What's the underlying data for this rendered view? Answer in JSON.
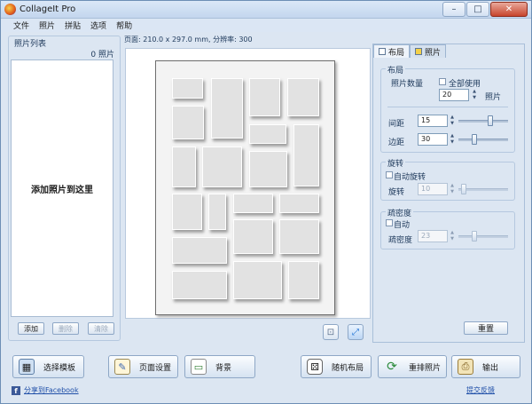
{
  "window": {
    "title": "CollageIt Pro",
    "min_glyph": "–",
    "max_glyph": "□",
    "close_glyph": "✕"
  },
  "menu": [
    "文件",
    "照片",
    "拼贴",
    "选项",
    "帮助"
  ],
  "photo_list": {
    "legend": "照片列表",
    "count": "0 照片",
    "hint": "添加照片到这里",
    "add_label": "添加",
    "delete_label": "删除",
    "clear_label": "清除"
  },
  "page_info": "页面: 210.0 x 297.0 mm, 分辨率: 300",
  "tabs": {
    "layout": "布局",
    "photo": "照片"
  },
  "layout_group": {
    "title": "布局",
    "photo_count_label": "照片数量",
    "use_all_label": "全部使用",
    "photo_count_value": "20",
    "photo_unit": "照片",
    "spacing_label": "间距",
    "spacing_value": "15",
    "spacing_level": 0.65,
    "margin_label": "边距",
    "margin_value": "30",
    "margin_level": 0.3
  },
  "rotation_group": {
    "title": "旋转",
    "auto_label": "自动旋转",
    "rotate_label": "旋转",
    "rotate_value": "10",
    "rotate_level": 0.05
  },
  "sparsity_group": {
    "title": "疏密度",
    "auto_label": "自动",
    "sparsity_label": "疏密度",
    "sparsity_value": "23",
    "sparsity_level": 0.3
  },
  "reset_label": "重置",
  "bottom": {
    "template_label": "选择模板",
    "page_setup_label": "页面设置",
    "background_label": "背景",
    "random_layout_label": "随机布局",
    "shuffle_label": "重排照片",
    "export_label": "输出"
  },
  "share_label": "分享到Facebook",
  "feedback_label": "提交反馈"
}
